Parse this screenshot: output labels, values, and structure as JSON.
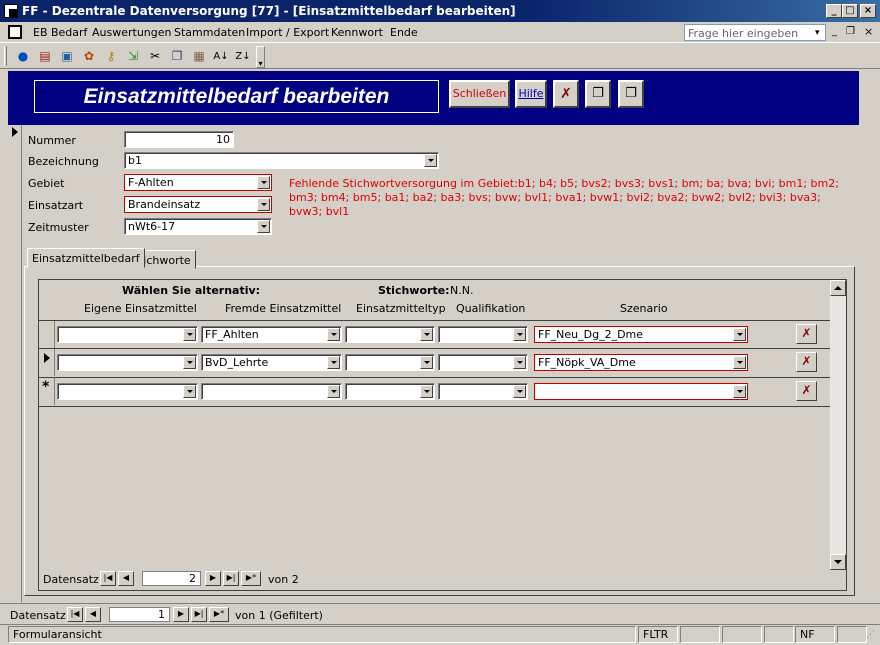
{
  "window": {
    "title": "FF - Dezentrale Datenversorgung [77] - [Einsatzmittelbedarf bearbeiten]"
  },
  "menu": {
    "items": [
      {
        "label": "EB Bedarf"
      },
      {
        "label": "Auswertungen"
      },
      {
        "label": "Stammdaten"
      },
      {
        "label": "Import / Export"
      },
      {
        "label": "Kennwort"
      },
      {
        "label": "Ende"
      }
    ],
    "help_placeholder": "Frage hier eingeben"
  },
  "header": {
    "title": "Einsatzmittelbedarf bearbeiten",
    "close_label": "Schließen",
    "help_label": "Hilfe"
  },
  "form": {
    "nummer_label": "Nummer",
    "nummer_value": "10",
    "bezeichnung_label": "Bezeichnung",
    "bezeichnung_value": "b1",
    "gebiet_label": "Gebiet",
    "gebiet_value": "F-Ahlten",
    "einsatzart_label": "Einsatzart",
    "einsatzart_value": "Brandeinsatz",
    "zeitmuster_label": "Zeitmuster",
    "zeitmuster_value": "nWt6-17",
    "warning": "Fehlende Stichwortversorgung im Gebiet:b1; b4; b5; bvs2; bvs3; bvs1; bm; ba; bva; bvi; bm1; bm2; bm3; bm4; bm5; ba1; ba2; ba3; bvs; bvw; bvl1; bva1; bvw1; bvi2; bva2; bvw2; bvl2; bvi3; bva3; bvw3; bvl1"
  },
  "tabs": [
    {
      "label": "Einsatzmittelbedarf"
    },
    {
      "label": "Stichworte"
    }
  ],
  "subform": {
    "alt_label": "Wählen Sie alternativ:",
    "stichworte_label": "Stichworte:",
    "stichworte_value": "N.N.",
    "columns": [
      "Eigene Einsatzmittel",
      "Fremde Einsatzmittel",
      "Einsatzmitteltyp",
      "Qualifikation",
      "Szenario"
    ],
    "rows": [
      {
        "eigene": "",
        "fremde": "FF_Ahlten",
        "typ": "",
        "qualifikation": "",
        "szenario": "FF_Neu_Dg_2_Dme"
      },
      {
        "eigene": "",
        "fremde": "BvD_Lehrte",
        "typ": "",
        "qualifikation": "",
        "szenario": "FF_Nöpk_VA_Dme"
      },
      {
        "eigene": "",
        "fremde": "",
        "typ": "",
        "qualifikation": "",
        "szenario": ""
      }
    ],
    "new_row_marker": "*",
    "delete_glyph": "✗",
    "nav_label": "Datensatz:",
    "nav_value": "2",
    "nav_of": "von  2"
  },
  "main_nav": {
    "label": "Datensatz:",
    "value": "1",
    "of": "von  1 (Gefiltert)"
  },
  "status": {
    "left": "Formularansicht",
    "fltr": "FLTR",
    "nf": "NF"
  }
}
